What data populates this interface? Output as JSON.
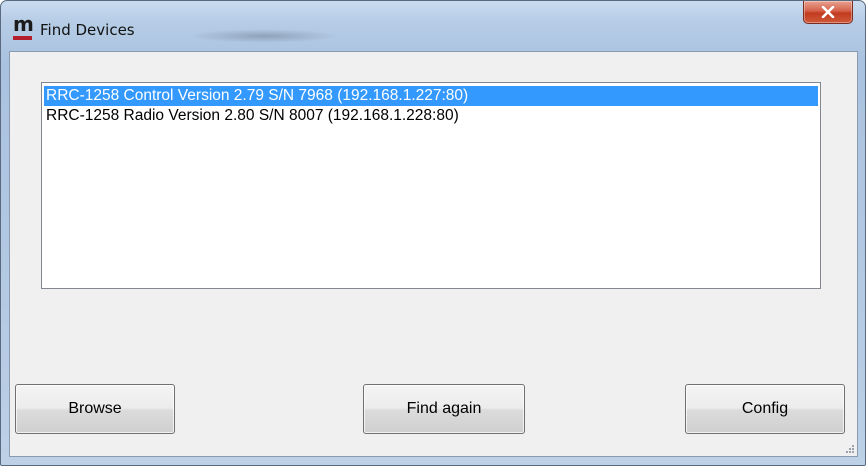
{
  "window": {
    "title": "Find Devices",
    "logo_letter": "m",
    "icon": "app-logo-icon",
    "close_icon": "close-icon"
  },
  "devices": {
    "selected_index": 0,
    "items": [
      "RRC-1258 Control Version 2.79 S/N 7968 (192.168.1.227:80)",
      "RRC-1258 Radio Version 2.80 S/N 8007 (192.168.1.228:80)"
    ]
  },
  "buttons": {
    "browse": "Browse",
    "find_again": "Find again",
    "config": "Config"
  },
  "colors": {
    "selection": "#3399ff",
    "close_button": "#c23c1f",
    "logo_bar": "#b31f2c"
  }
}
